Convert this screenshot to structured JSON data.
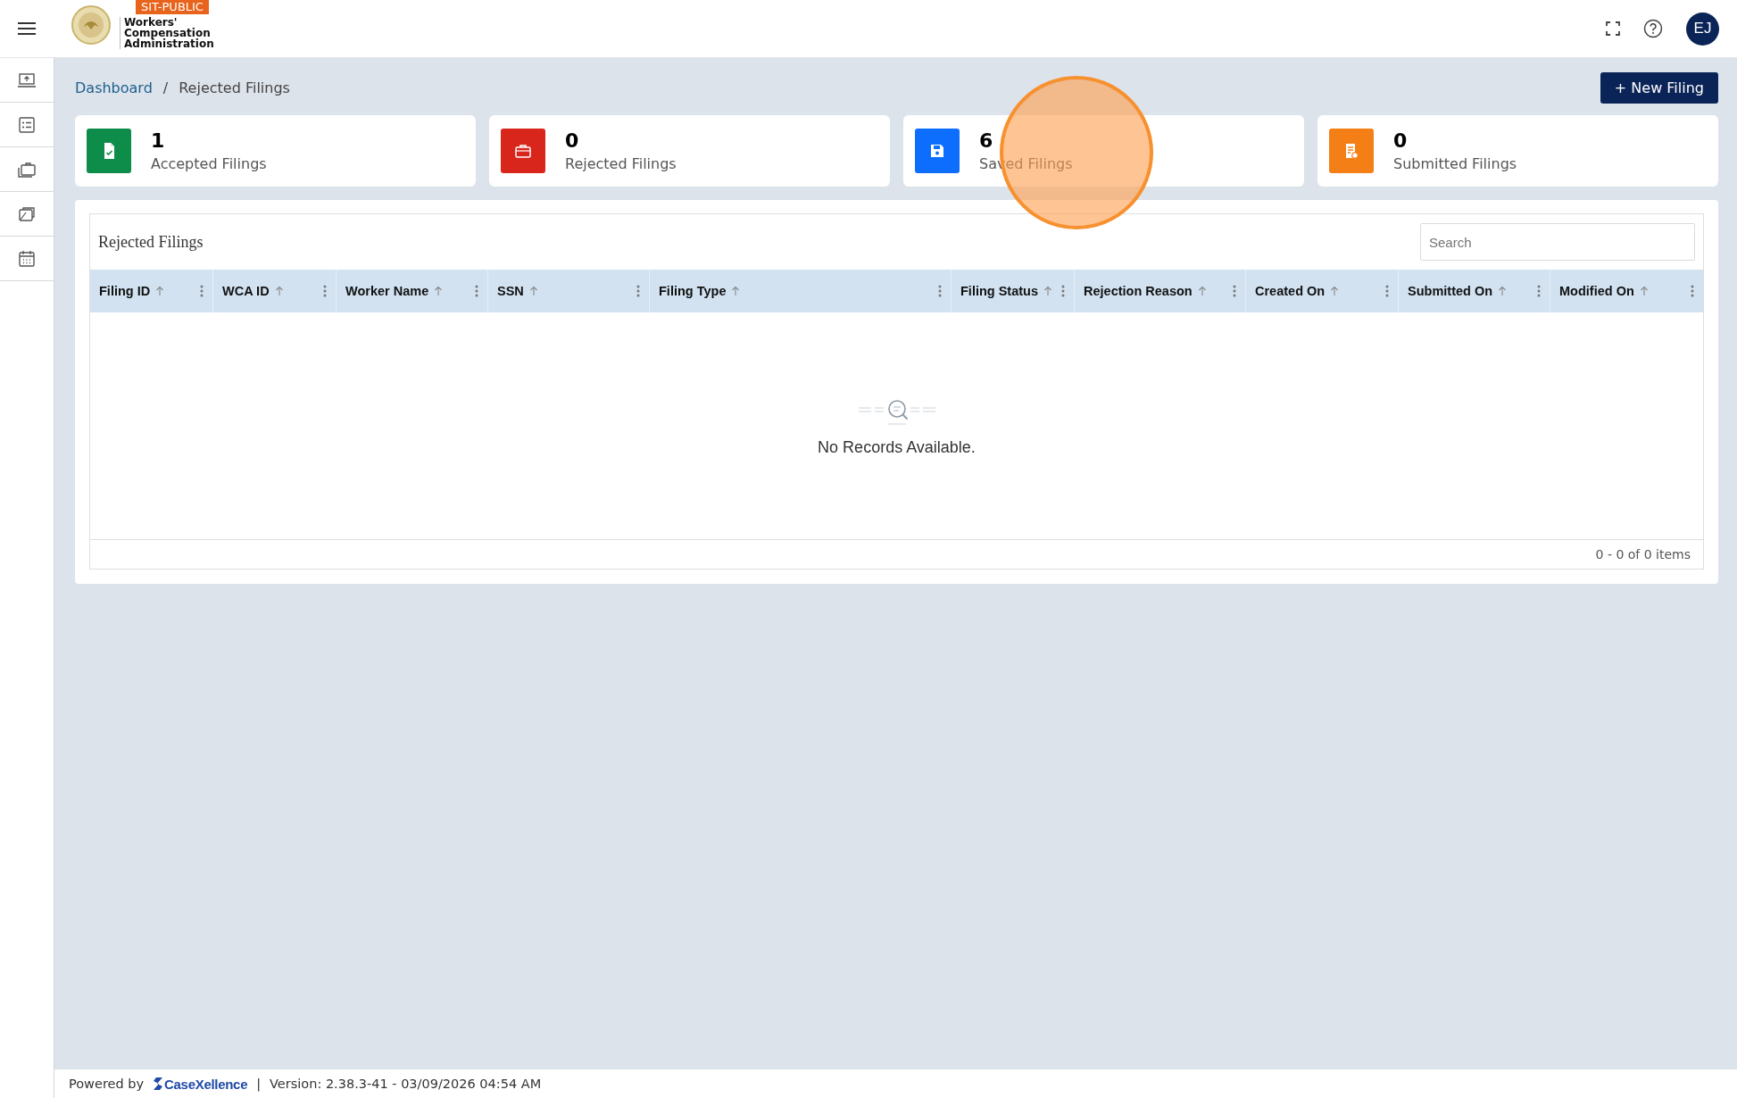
{
  "header": {
    "badge": "SIT-PUBLIC",
    "org_name": "Workers' Compensation Administration",
    "avatar": "EJ"
  },
  "breadcrumb": [
    {
      "label": "Dashboard",
      "kind": "link"
    },
    {
      "label": "/",
      "kind": "separator"
    },
    {
      "label": "Rejected Filings",
      "kind": "current"
    }
  ],
  "new_button": "+ New Filing",
  "stats": [
    {
      "count": "1",
      "label": "Accepted Filings",
      "kind": "accepted",
      "color": "#0e8c4a"
    },
    {
      "count": "0",
      "label": "Rejected Filings",
      "kind": "rejected",
      "color": "#d9261c"
    },
    {
      "count": "6",
      "label": "Saved Filings",
      "kind": "saved",
      "color": "#0d6efd"
    },
    {
      "count": "0",
      "label": "Submitted Filings",
      "kind": "submitted",
      "color": "#f57f17"
    }
  ],
  "table": {
    "title": "Rejected Filings",
    "search": {
      "placeholder": "Search"
    },
    "columns": [
      "Filing ID",
      "WCA ID",
      "Worker Name",
      "SSN",
      "Filing Type",
      "Filing Status",
      "Rejection Reason",
      "Created On",
      "Submitted On",
      "Modified On"
    ],
    "empty_text": "No Records Available.",
    "pager": "0 - 0 of 0 items"
  },
  "footer": {
    "powered_by": "Powered by",
    "brand": "CaseXellence",
    "separator": "|",
    "version": "Version: 2.38.3-41 - 03/09/2026 04:54 AM"
  }
}
